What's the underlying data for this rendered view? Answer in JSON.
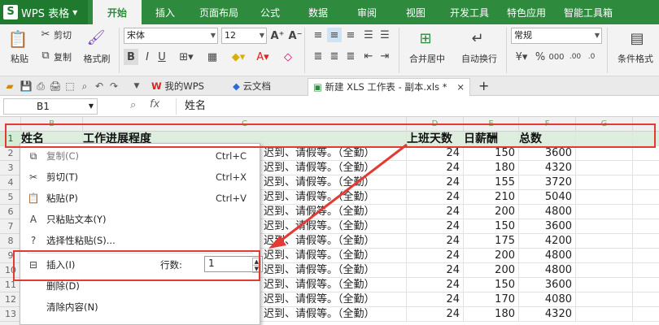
{
  "app": {
    "name": "WPS 表格",
    "logo": "S"
  },
  "tabs": [
    "开始",
    "插入",
    "页面布局",
    "公式",
    "数据",
    "审阅",
    "视图",
    "开发工具",
    "特色应用",
    "智能工具箱"
  ],
  "active_tab": "开始",
  "ribbon": {
    "paste": "粘贴",
    "cut": "剪切",
    "copy": "复制",
    "format_painter": "格式刷",
    "font_name": "宋体",
    "font_size": "12",
    "merge_center": "合并居中",
    "wrap_text": "自动换行",
    "number_format": "常规",
    "conditional_format": "条件格式"
  },
  "quick_tabs": {
    "wps": "我的WPS",
    "cloud": "云文档",
    "doc": "新建 XLS 工作表 - 副本.xls *",
    "close": "×",
    "add": "+"
  },
  "formula_bar": {
    "cell_ref": "B1",
    "fx": "fx",
    "content": "姓名"
  },
  "columns": [
    "B",
    "C",
    "D",
    "E",
    "F",
    "G"
  ],
  "rows": [
    "1",
    "2",
    "3",
    "4",
    "5",
    "6",
    "7",
    "8",
    "9",
    "10",
    "11",
    "12",
    "13"
  ],
  "header_row": {
    "name": "姓名",
    "progress": "工作进展程度",
    "days": "上班天数",
    "daily_pay": "日薪酬",
    "total": "总数"
  },
  "row_text": "迟到、请假等。（全勤）",
  "data_rows": [
    {
      "days": "24",
      "pay": "150",
      "total": "3600"
    },
    {
      "days": "24",
      "pay": "180",
      "total": "4320"
    },
    {
      "days": "24",
      "pay": "155",
      "total": "3720"
    },
    {
      "days": "24",
      "pay": "210",
      "total": "5040"
    },
    {
      "days": "24",
      "pay": "200",
      "total": "4800"
    },
    {
      "days": "24",
      "pay": "150",
      "total": "3600"
    },
    {
      "days": "24",
      "pay": "175",
      "total": "4200"
    },
    {
      "days": "24",
      "pay": "200",
      "total": "4800"
    },
    {
      "days": "24",
      "pay": "200",
      "total": "4800"
    },
    {
      "days": "24",
      "pay": "150",
      "total": "3600"
    },
    {
      "days": "24",
      "pay": "170",
      "total": "4080"
    },
    {
      "days": "24",
      "pay": "180",
      "total": "4320"
    }
  ],
  "context_menu": {
    "copy": {
      "label": "复制(C)",
      "key": "Ctrl+C"
    },
    "cut": {
      "label": "剪切(T)",
      "key": "Ctrl+X"
    },
    "paste": {
      "label": "粘贴(P)",
      "key": "Ctrl+V"
    },
    "paste_text": {
      "label": "只粘贴文本(Y)"
    },
    "paste_special": {
      "label": "选择性粘贴(S)..."
    },
    "insert": {
      "label": "插入(I)",
      "rows_label": "行数:",
      "rows_value": "1"
    },
    "delete": {
      "label": "删除(D)"
    },
    "clear": {
      "label": "清除内容(N)"
    }
  },
  "colors": {
    "accent": "#2e8b3e",
    "annotation": "#e23b35"
  }
}
